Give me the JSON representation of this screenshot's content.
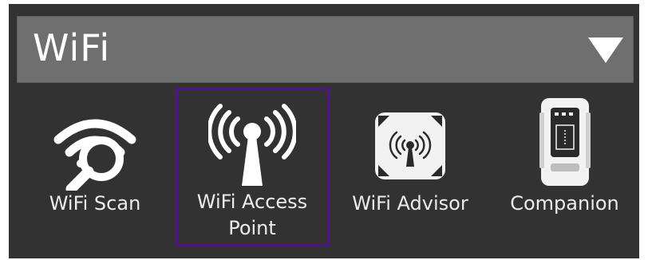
{
  "header": {
    "title": "WiFi",
    "dropdown_icon": "triangle-down-icon"
  },
  "apps": [
    {
      "label": "WiFi Scan",
      "icon": "wifi-scan-icon",
      "selected": false
    },
    {
      "label": "WiFi Access Point",
      "label_line1": "WiFi Access",
      "label_line2": "Point",
      "icon": "access-point-icon",
      "selected": true
    },
    {
      "label": "WiFi Advisor",
      "icon": "wifi-advisor-icon",
      "selected": false
    },
    {
      "label": "Companion",
      "icon": "companion-device-icon",
      "selected": false
    }
  ],
  "colors": {
    "panel": "#323232",
    "header": "#6f6f6f",
    "selection_border": "#4b1a78",
    "text": "#ffffff"
  }
}
